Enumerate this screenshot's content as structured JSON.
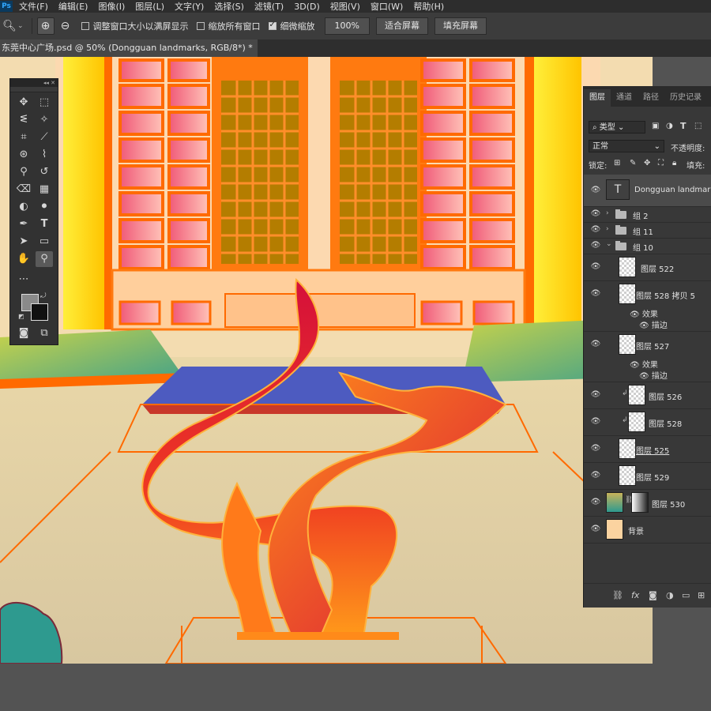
{
  "app": {
    "logo": "Ps"
  },
  "menu": [
    "文件(F)",
    "编辑(E)",
    "图像(I)",
    "图层(L)",
    "文字(Y)",
    "选择(S)",
    "滤镜(T)",
    "3D(D)",
    "视图(V)",
    "窗口(W)",
    "帮助(H)"
  ],
  "options": {
    "check_resize": "调整窗口大小以满屏显示",
    "check_all": "缩放所有窗口",
    "check_scrubby": "细微缩放",
    "zoom_value": "100%",
    "fit_screen": "适合屏幕",
    "fill_screen": "填充屏幕"
  },
  "document": {
    "tab_title": "东莞中心广场.psd @ 50% (Dongguan landmarks, RGB/8*) *"
  },
  "panel": {
    "tabs": [
      "图层",
      "通道",
      "路径",
      "历史记录"
    ],
    "filter_label": "类型",
    "blend_mode": "正常",
    "opacity_label": "不透明度:",
    "lock_label": "锁定:",
    "fill_label": "填充:",
    "layers": [
      {
        "name": "Dongguan landmarks"
      },
      {
        "name": "组 2"
      },
      {
        "name": "组 11"
      },
      {
        "name": "组 10"
      },
      {
        "name": "图层 522"
      },
      {
        "name": "图层 528 拷贝 5",
        "effects": "效果",
        "stroke": "描边"
      },
      {
        "name": "图层 527",
        "effects": "效果",
        "stroke": "描边"
      },
      {
        "name": "图层 526"
      },
      {
        "name": "图层 528"
      },
      {
        "name": "图层 525"
      },
      {
        "name": "图层 529"
      },
      {
        "name": "图层 530"
      },
      {
        "name": "背景"
      }
    ]
  },
  "colors": {
    "accent_red": "#d7153c",
    "orange": "#ff6a00",
    "teal": "#2e9a8f"
  }
}
